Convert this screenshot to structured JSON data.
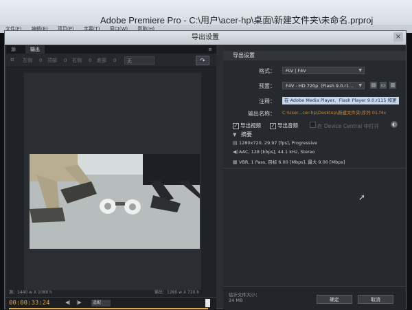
{
  "app": {
    "title": "Adobe Premiere Pro - C:\\用户\\acer-hp\\桌面\\新建文件夹\\未命名.prproj",
    "menu": [
      "文件(F)",
      "编辑(E)",
      "项目(P)",
      "字幕(T)",
      "窗口(W)",
      "帮助(H)"
    ]
  },
  "dialog": {
    "title": "导出设置",
    "close_label": "×"
  },
  "left_panel": {
    "tabs": [
      "源",
      "输出"
    ],
    "active_tab": "输出",
    "tab_menu_icon": "menu-icon",
    "toolbar": {
      "crop_icon": "crop-icon",
      "left_label": "左侧",
      "left_value": "0",
      "top_label": "顶部",
      "top_value": "0",
      "right_label": "右侧",
      "right_value": "0",
      "bottom_label": "底部",
      "bottom_value": "0",
      "aspect_select": "无",
      "export_icon": "arrow-icon"
    },
    "source_label": "源：1440 w X 1080 h",
    "output_label": "输出：1280 w X 720 h",
    "timecode": "00:00:33:24",
    "fit_select": "适配"
  },
  "right_panel": {
    "section_title": "导出设置",
    "format_label": "格式：",
    "format_value": "FLV | F4V",
    "preset_label": "预置：",
    "preset_value": "F4V - HD 720p（Flash 9.0.r1...",
    "save_preset_icon": "save-icon",
    "import_preset_icon": "folder-icon",
    "delete_preset_icon": "trash-icon",
    "comment_label": "注释：",
    "comment_value": "在 Adobe Media Player、Flash Player 9.0.r115 和更",
    "output_name_label": "输出名称：",
    "output_name_value": "C:\\User...cer-hp\\Desktop\\新建文件夹\\序列 01.f4v",
    "export_video_label": "导出视频",
    "export_video_checked": true,
    "export_audio_label": "导出音频",
    "export_audio_checked": true,
    "device_central_label": "在 Device Central 中打开",
    "device_central_checked": false,
    "summary_title": "摘要",
    "summary_lines": [
      "1280x720, 29.97 [fps], Progressive",
      "AAC, 128 [kbps], 44.1 kHz, Stereo",
      "VBR, 1 Pass, 目标 6.00 [Mbps], 最大 9.00 [Mbps]"
    ],
    "estimated_size_label": "估计文件大小：",
    "estimated_size_value": "24 MB",
    "ok_label": "确定",
    "cancel_label": "取消"
  }
}
